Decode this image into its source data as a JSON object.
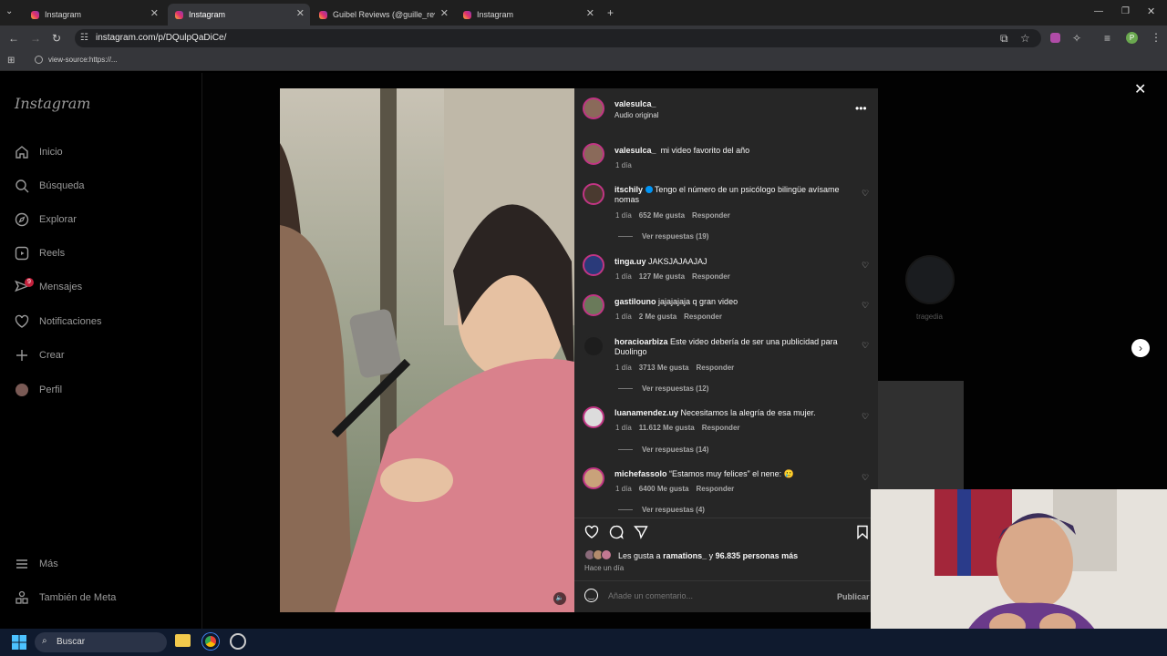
{
  "browser": {
    "tabs": [
      {
        "title": "Instagram",
        "active": false
      },
      {
        "title": "Instagram",
        "active": true
      },
      {
        "title": "Guibel Reviews (@guille_review",
        "active": false
      },
      {
        "title": "Instagram",
        "active": false
      }
    ],
    "url": "instagram.com/p/DQulpQaDiCe/",
    "bookmark": "view-source:https://...",
    "new_tab": "+",
    "profile_initial": "P"
  },
  "sidebar": {
    "logo": "Instagram",
    "items": [
      {
        "label": "Inicio",
        "icon": "home-icon"
      },
      {
        "label": "Búsqueda",
        "icon": "search-icon"
      },
      {
        "label": "Explorar",
        "icon": "compass-icon"
      },
      {
        "label": "Reels",
        "icon": "reels-icon"
      },
      {
        "label": "Mensajes",
        "icon": "messenger-icon",
        "badge": "9"
      },
      {
        "label": "Notificaciones",
        "icon": "heart-icon"
      },
      {
        "label": "Crear",
        "icon": "plus-icon"
      },
      {
        "label": "Perfil",
        "icon": "avatar"
      }
    ],
    "more": "Más",
    "meta": "También de Meta"
  },
  "post": {
    "author": "valesulca_",
    "audio": "Audio original",
    "caption": {
      "user": "valesulca_",
      "text": "mi video favorito del año",
      "time": "1 día"
    },
    "comments": [
      {
        "user": "itschily",
        "verified": true,
        "text": "Tengo el número de un psicólogo bilingüe avísame nomas",
        "time": "1 día",
        "likes": "652 Me gusta",
        "reply": "Responder",
        "replies": "Ver respuestas (19)"
      },
      {
        "user": "tinga.uy",
        "text": "JAKSJAJAAJAJ",
        "time": "1 día",
        "likes": "127 Me gusta",
        "reply": "Responder"
      },
      {
        "user": "gastilouno",
        "text": "jajajajaja q gran video",
        "time": "1 día",
        "likes": "2 Me gusta",
        "reply": "Responder"
      },
      {
        "user": "horacioarbiza",
        "text": "Este video debería de ser una publicidad para Duolingo",
        "time": "1 día",
        "likes": "3713 Me gusta",
        "reply": "Responder",
        "replies": "Ver respuestas (12)"
      },
      {
        "user": "luanamendez.uy",
        "text": "Necesitamos la alegría de esa mujer.",
        "time": "1 día",
        "likes": "11.612 Me gusta",
        "reply": "Responder",
        "replies": "Ver respuestas (14)"
      },
      {
        "user": "michefassolo",
        "text": "“Estamos muy felices” el nene: 🥲",
        "time": "1 día",
        "likes": "6400 Me gusta",
        "reply": "Responder",
        "replies": "Ver respuestas (4)"
      }
    ],
    "likes_prefix": "Les gusta a",
    "likes_user": "ramations_",
    "likes_mid": "y",
    "likes_count": "96.835 personas más",
    "posted": "Hace un día",
    "comment_placeholder": "Añade un comentario...",
    "publish": "Publicar"
  },
  "background": {
    "thumb_label": "tragedia"
  },
  "taskbar": {
    "search": "Buscar"
  },
  "colors": {
    "accent": "#c13584",
    "link": "#0095f6",
    "verified": "#0095f6"
  }
}
